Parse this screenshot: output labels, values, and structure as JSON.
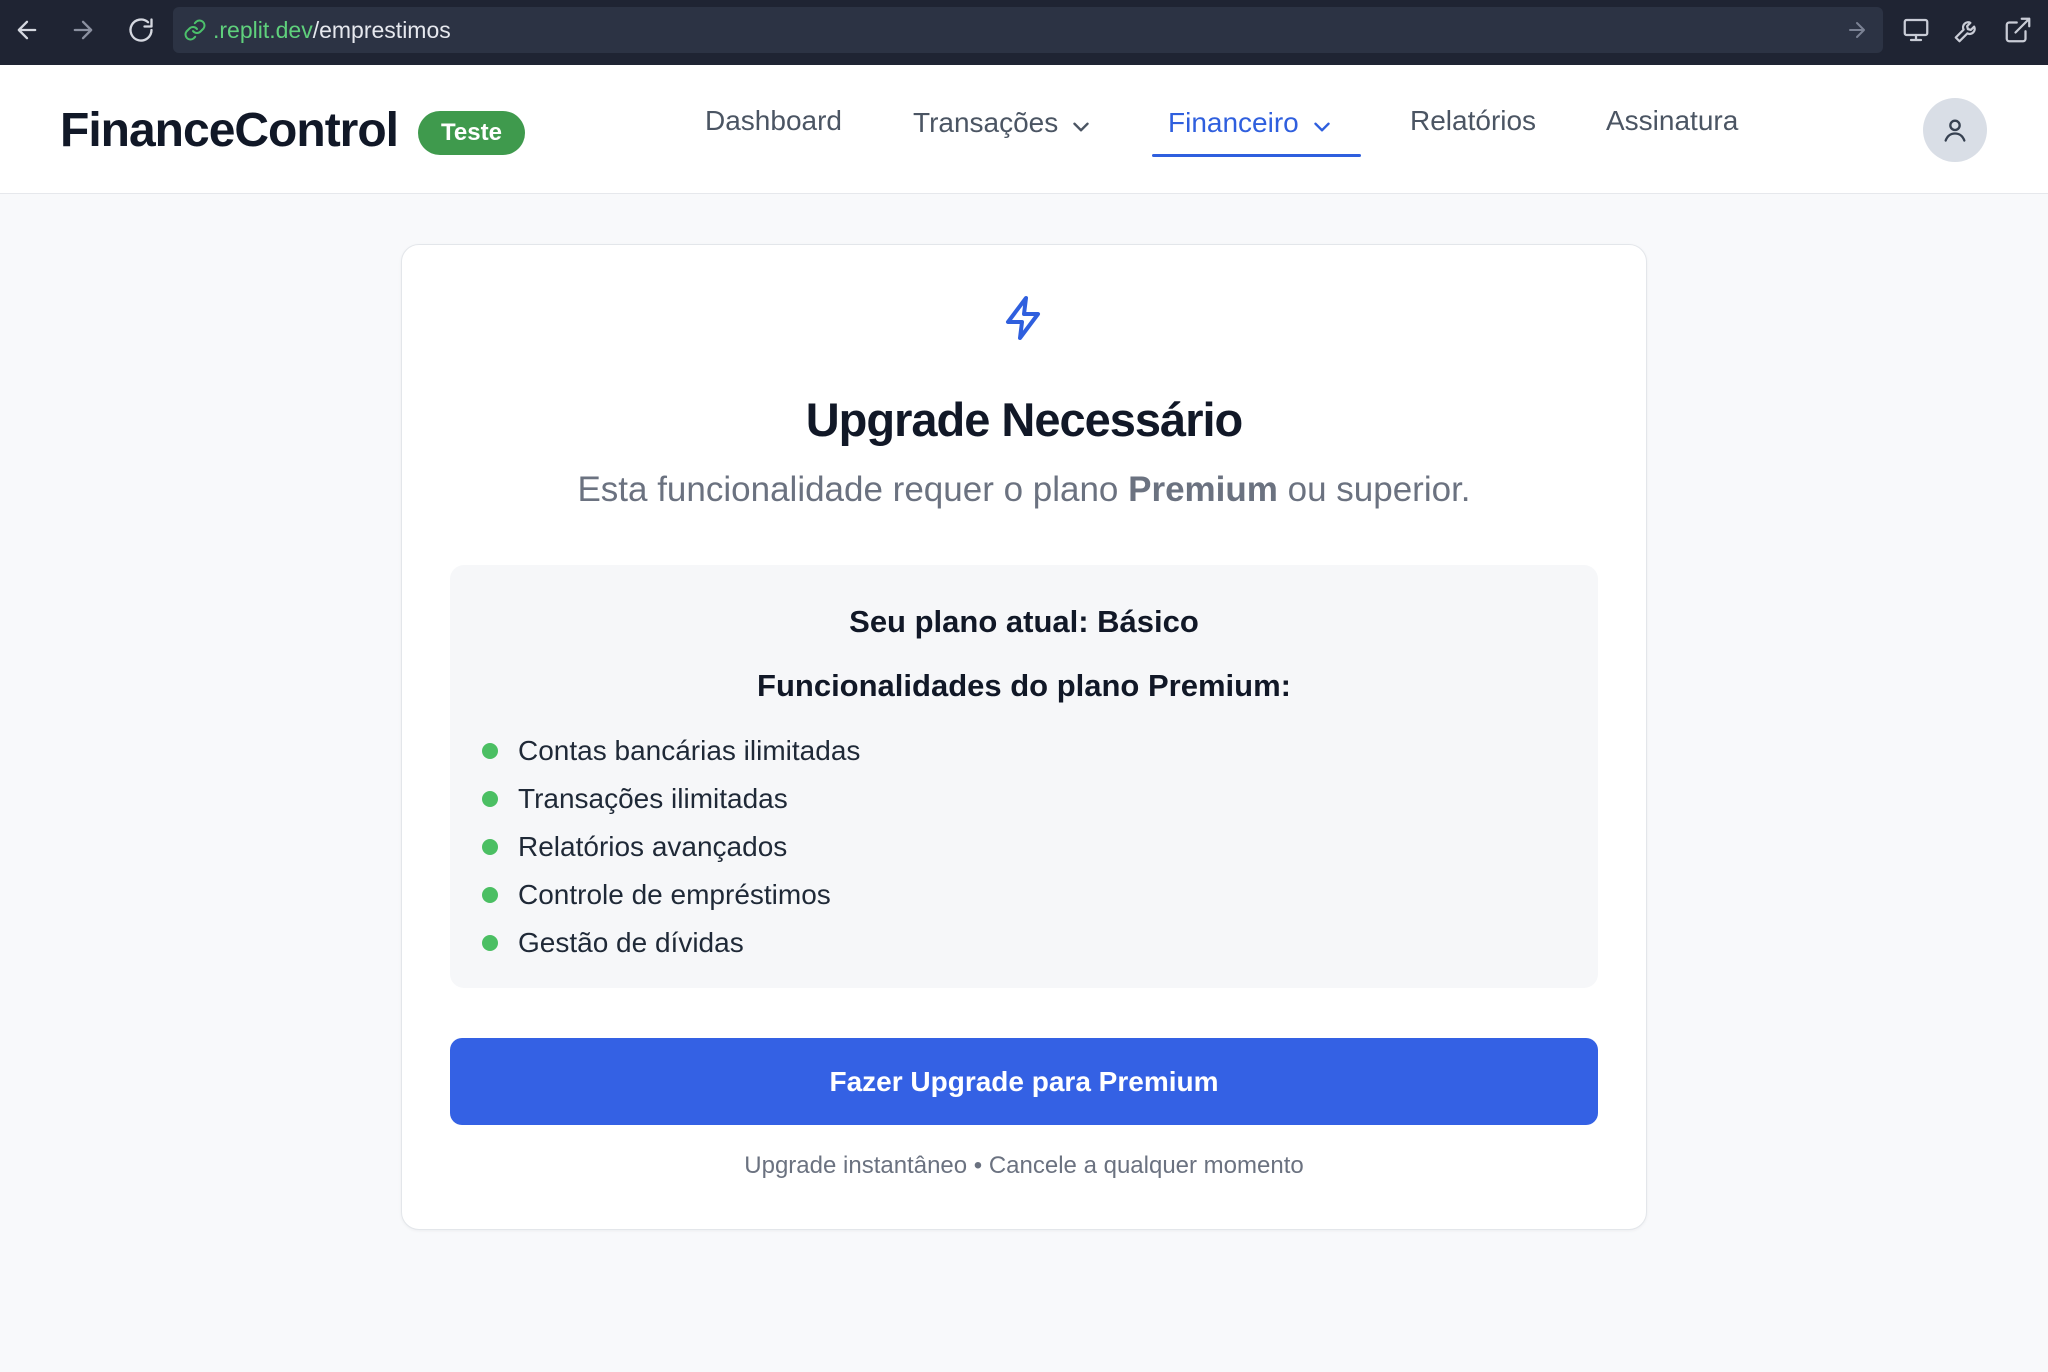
{
  "browser": {
    "url_domain": ".replit.dev",
    "url_path": "/emprestimos"
  },
  "header": {
    "brand": "FinanceControl",
    "badge": "Teste",
    "nav": [
      {
        "label": "Dashboard"
      },
      {
        "label": "Transações"
      },
      {
        "label": "Financeiro"
      },
      {
        "label": "Relatórios"
      },
      {
        "label": "Assinatura"
      }
    ],
    "active_nav": "Financeiro"
  },
  "card": {
    "icon": "zap-icon",
    "title": "Upgrade Necessário",
    "subtitle_prefix": "Esta funcionalidade requer o plano ",
    "subtitle_plan": "Premium",
    "subtitle_suffix": " ou superior.",
    "current_plan": "Seu plano atual: Básico",
    "features_title": "Funcionalidades do plano Premium:",
    "features": [
      "Contas bancárias ilimitadas",
      "Transações ilimitadas",
      "Relatórios avançados",
      "Controle de empréstimos",
      "Gestão de dívidas"
    ],
    "button_label": "Fazer Upgrade para Premium",
    "footnote": "Upgrade instantâneo • Cancele a qualquer momento"
  },
  "colors": {
    "accent": "#3461e4",
    "badge": "#3f9a4d",
    "feature_dot": "#4bbf63",
    "browser_bar": "#1f2433"
  }
}
